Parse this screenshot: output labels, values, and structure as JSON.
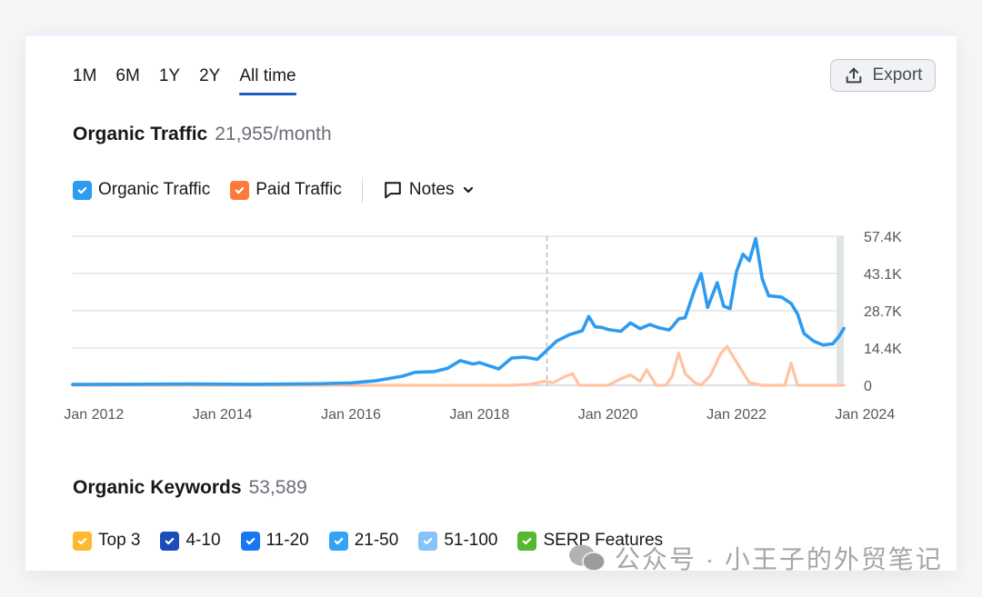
{
  "period_tabs": [
    {
      "label": "1M",
      "active": false
    },
    {
      "label": "6M",
      "active": false
    },
    {
      "label": "1Y",
      "active": false
    },
    {
      "label": "2Y",
      "active": false
    },
    {
      "label": "All time",
      "active": true
    }
  ],
  "export_button": {
    "label": "Export",
    "icon": "upload-icon"
  },
  "organic_traffic": {
    "title": "Organic Traffic",
    "value": "21,955/month"
  },
  "traffic_legend": [
    {
      "label": "Organic Traffic",
      "checked": true,
      "color": "#2d9cf0"
    },
    {
      "label": "Paid Traffic",
      "checked": true,
      "color": "#ff7a3a"
    }
  ],
  "notes": {
    "label": "Notes",
    "icon": "comment-icon"
  },
  "organic_keywords": {
    "title": "Organic Keywords",
    "value": "53,589"
  },
  "keyword_legend": [
    {
      "label": "Top 3",
      "checked": true,
      "color": "#ffb930"
    },
    {
      "label": "4-10",
      "checked": true,
      "color": "#1a4db8"
    },
    {
      "label": "11-20",
      "checked": true,
      "color": "#1a75f0"
    },
    {
      "label": "21-50",
      "checked": true,
      "color": "#35a3f5"
    },
    {
      "label": "51-100",
      "checked": true,
      "color": "#86c3fa"
    },
    {
      "label": "SERP Features",
      "checked": true,
      "color": "#55b82e"
    }
  ],
  "watermark": {
    "text": "公众号 · 小王子的外贸笔记"
  },
  "chart_data": {
    "type": "line",
    "title": "Organic Traffic",
    "xlabel": "",
    "ylabel": "",
    "x_ticks": [
      "Jan 2012",
      "Jan 2014",
      "Jan 2016",
      "Jan 2018",
      "Jan 2020",
      "Jan 2022",
      "Jan 2024"
    ],
    "x_tick_values": [
      2012,
      2014,
      2016,
      2018,
      2020,
      2022,
      2024
    ],
    "y_ticks": [
      "0",
      "14.4K",
      "28.7K",
      "43.1K",
      "57.4K"
    ],
    "y_tick_values": [
      0,
      14.4,
      28.7,
      43.1,
      57.4
    ],
    "xlim": [
      2011.67,
      2023.67
    ],
    "ylim": [
      0,
      57.4
    ],
    "y_unit": "K visits/month",
    "grid": true,
    "annotation_dashed_x": 2019.05,
    "series": [
      {
        "name": "Organic Traffic",
        "color": "#2d9cf0",
        "x": [
          2011.67,
          2012.5,
          2013.5,
          2014.5,
          2015.5,
          2016.0,
          2016.4,
          2016.8,
          2017.0,
          2017.3,
          2017.5,
          2017.7,
          2017.9,
          2018.0,
          2018.3,
          2018.5,
          2018.7,
          2018.9,
          2019.05,
          2019.2,
          2019.4,
          2019.6,
          2019.7,
          2019.8,
          2019.9,
          2020.0,
          2020.2,
          2020.35,
          2020.5,
          2020.65,
          2020.8,
          2020.95,
          2021.0,
          2021.1,
          2021.2,
          2021.35,
          2021.45,
          2021.55,
          2021.7,
          2021.8,
          2021.9,
          2022.0,
          2022.1,
          2022.2,
          2022.3,
          2022.4,
          2022.5,
          2022.7,
          2022.85,
          2022.95,
          2023.05,
          2023.2,
          2023.35,
          2023.5,
          2023.6,
          2023.67
        ],
        "y": [
          0.3,
          0.4,
          0.5,
          0.4,
          0.6,
          0.9,
          1.8,
          3.5,
          5.0,
          5.3,
          6.5,
          9.5,
          8.2,
          8.7,
          6.3,
          10.5,
          10.8,
          10.0,
          13.5,
          17.0,
          19.5,
          21.0,
          26.5,
          22.5,
          22.3,
          21.5,
          20.8,
          24.0,
          21.8,
          23.4,
          22.1,
          21.3,
          22.5,
          25.6,
          26.0,
          37.0,
          43.0,
          30.0,
          39.5,
          30.5,
          29.5,
          43.8,
          50.5,
          48.0,
          56.5,
          41.0,
          34.5,
          34.0,
          31.5,
          27.5,
          20.0,
          17.0,
          15.5,
          16.0,
          19.0,
          21.9
        ]
      },
      {
        "name": "Paid Traffic",
        "color": "#ffc3a3",
        "x": [
          2011.67,
          2018.5,
          2018.8,
          2019.0,
          2019.15,
          2019.3,
          2019.45,
          2019.55,
          2019.7,
          2019.9,
          2020.0,
          2020.2,
          2020.35,
          2020.5,
          2020.6,
          2020.75,
          2020.9,
          2021.0,
          2021.1,
          2021.2,
          2021.35,
          2021.45,
          2021.6,
          2021.75,
          2021.85,
          2022.0,
          2022.2,
          2022.4,
          2022.6,
          2022.75,
          2022.85,
          2022.95,
          2023.05,
          2023.67
        ],
        "y": [
          0,
          0,
          0.4,
          1.5,
          1.0,
          3.0,
          4.5,
          0,
          0,
          0,
          0,
          2.5,
          4.0,
          1.5,
          6.0,
          0,
          0,
          3.5,
          12.5,
          4.5,
          1.0,
          0,
          4.0,
          12.0,
          15.0,
          9.0,
          1.0,
          0,
          0,
          0,
          8.5,
          0,
          0,
          0
        ]
      }
    ]
  }
}
